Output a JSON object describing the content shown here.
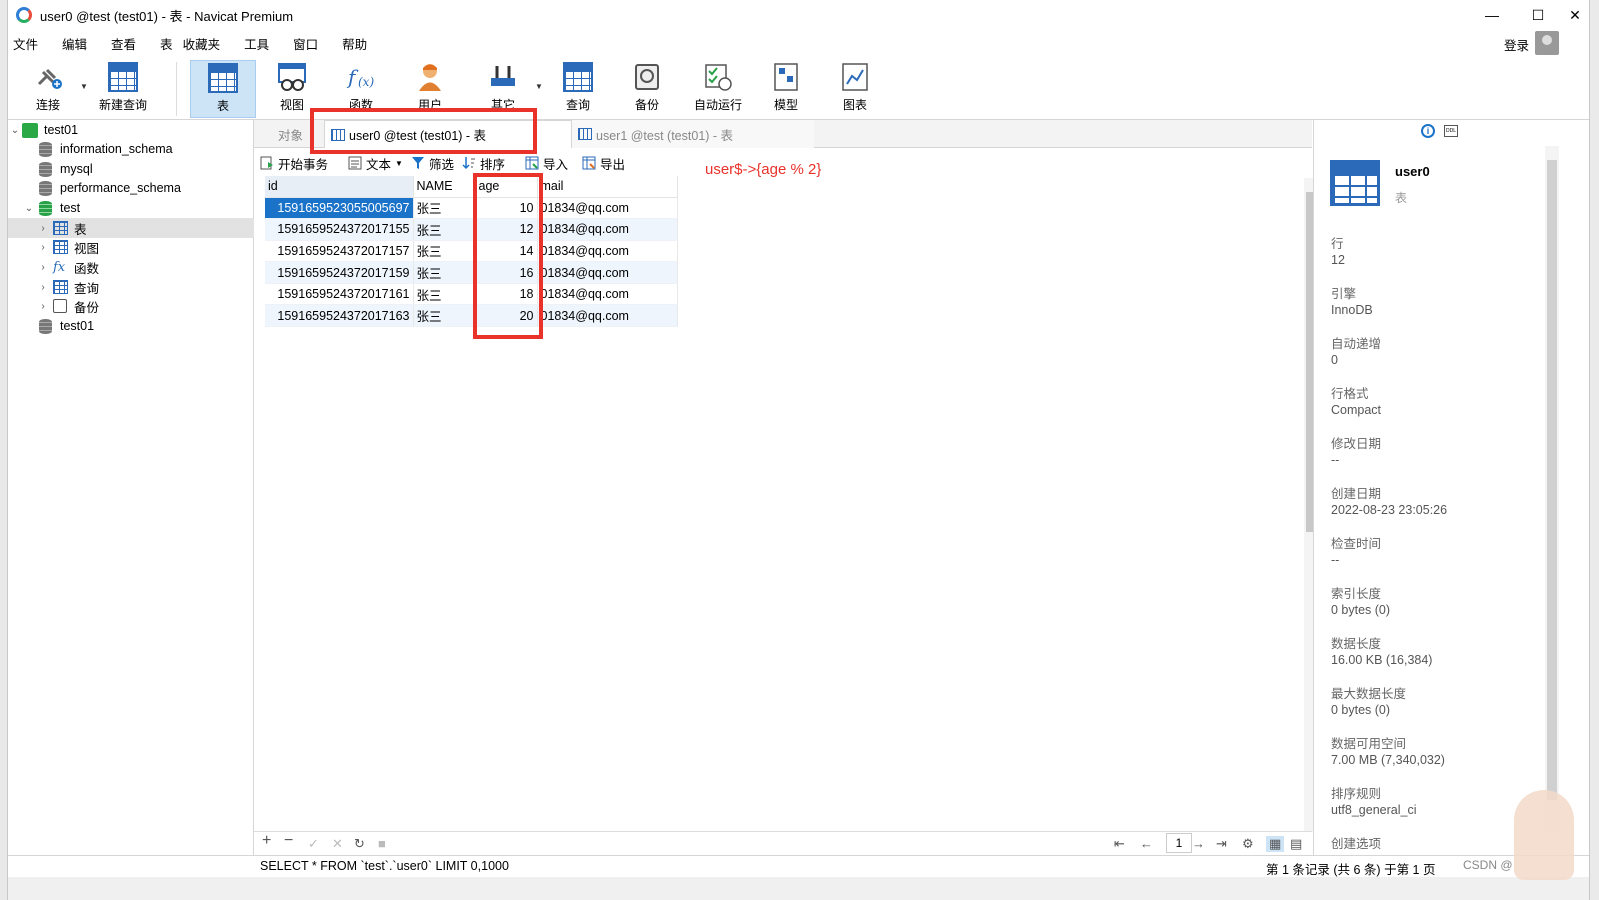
{
  "window": {
    "title": "user0 @test (test01) - 表 - Navicat Premium",
    "controls": {
      "minimize": "—",
      "maximize": "☐",
      "close": "✕"
    }
  },
  "menu": [
    "文件",
    "编辑",
    "查看",
    "表",
    "收藏夹",
    "工具",
    "窗口",
    "帮助"
  ],
  "account": {
    "login_label": "登录"
  },
  "toolbar": {
    "connect": "连接",
    "new_query": "新建查询",
    "table": "表",
    "view": "视图",
    "function": "函数",
    "user": "用户",
    "other": "其它",
    "query": "查询",
    "backup": "备份",
    "automation": "自动运行",
    "model": "模型",
    "chart": "图表"
  },
  "tree": {
    "connection": "test01",
    "databases": [
      "information_schema",
      "mysql",
      "performance_schema",
      "test"
    ],
    "test_children": [
      "表",
      "视图",
      "函数",
      "查询",
      "备份"
    ],
    "other_db": "test01"
  },
  "tabs": {
    "objects": "对象",
    "active": "user0 @test (test01) - 表",
    "other": "user1 @test (test01) - 表"
  },
  "grid_toolbar": {
    "begin_transaction": "开始事务",
    "text": "文本",
    "filter": "筛选",
    "sort": "排序",
    "import": "导入",
    "export": "导出"
  },
  "annotation": "user$->{age % 2}",
  "table": {
    "columns": [
      "id",
      "NAME",
      "age",
      "mail"
    ],
    "rows": [
      {
        "id": "1591659523055005697",
        "name": "张三",
        "age": "10",
        "mail": "01834@qq.com"
      },
      {
        "id": "1591659524372017155",
        "name": "张三",
        "age": "12",
        "mail": "01834@qq.com"
      },
      {
        "id": "1591659524372017157",
        "name": "张三",
        "age": "14",
        "mail": "01834@qq.com"
      },
      {
        "id": "1591659524372017159",
        "name": "张三",
        "age": "16",
        "mail": "01834@qq.com"
      },
      {
        "id": "1591659524372017161",
        "name": "张三",
        "age": "18",
        "mail": "01834@qq.com"
      },
      {
        "id": "1591659524372017163",
        "name": "张三",
        "age": "20",
        "mail": "01834@qq.com"
      }
    ]
  },
  "bottom_bar": {
    "page": "1"
  },
  "status": {
    "sql": "SELECT * FROM `test`.`user0` LIMIT 0,1000",
    "records": "第 1 条记录 (共 6 条) 于第 1 页"
  },
  "info": {
    "name": "user0",
    "type": "表",
    "props": [
      {
        "k": "行",
        "v": "12"
      },
      {
        "k": "引擎",
        "v": "InnoDB"
      },
      {
        "k": "自动递增",
        "v": "0"
      },
      {
        "k": "行格式",
        "v": "Compact"
      },
      {
        "k": "修改日期",
        "v": "--"
      },
      {
        "k": "创建日期",
        "v": "2022-08-23 23:05:26"
      },
      {
        "k": "检查时间",
        "v": "--"
      },
      {
        "k": "索引长度",
        "v": "0 bytes (0)"
      },
      {
        "k": "数据长度",
        "v": "16.00 KB (16,384)"
      },
      {
        "k": "最大数据长度",
        "v": "0 bytes (0)"
      },
      {
        "k": "数据可用空间",
        "v": "7.00 MB (7,340,032)"
      },
      {
        "k": "排序规则",
        "v": "utf8_general_ci"
      },
      {
        "k": "创建选项",
        "v": ""
      }
    ]
  },
  "watermark": "CSDN @"
}
